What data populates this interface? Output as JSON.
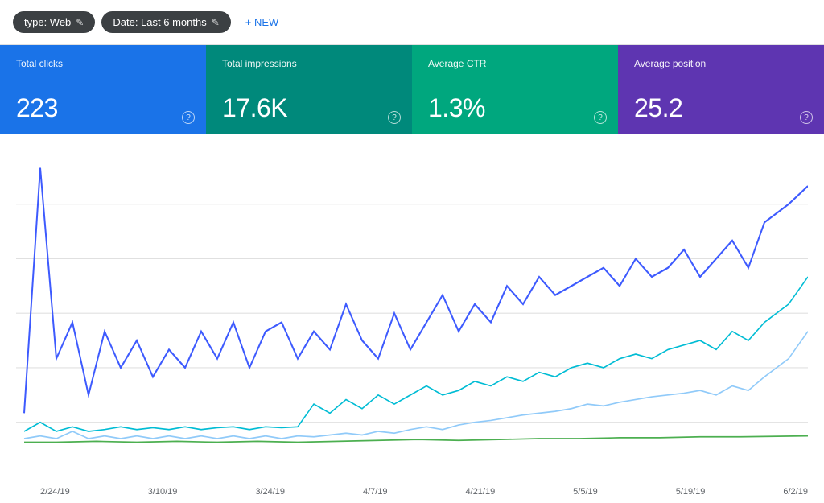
{
  "toolbar": {
    "type_filter_label": "type: Web",
    "date_filter_label": "Date: Last 6 months",
    "new_button_label": "+ NEW"
  },
  "metrics": [
    {
      "id": "total-clicks",
      "label": "Total clicks",
      "value": "223",
      "color": "blue"
    },
    {
      "id": "total-impressions",
      "label": "Total impressions",
      "value": "17.6K",
      "color": "teal"
    },
    {
      "id": "average-ctr",
      "label": "Average CTR",
      "value": "1.3%",
      "color": "green"
    },
    {
      "id": "average-position",
      "label": "Average position",
      "value": "25.2",
      "color": "purple"
    }
  ],
  "chart": {
    "x_labels": [
      "2/24/19",
      "3/10/19",
      "3/24/19",
      "4/7/19",
      "4/21/19",
      "5/5/19",
      "5/19/19",
      "6/2/19"
    ]
  },
  "icons": {
    "edit": "✎",
    "plus": "+",
    "help": "?"
  }
}
